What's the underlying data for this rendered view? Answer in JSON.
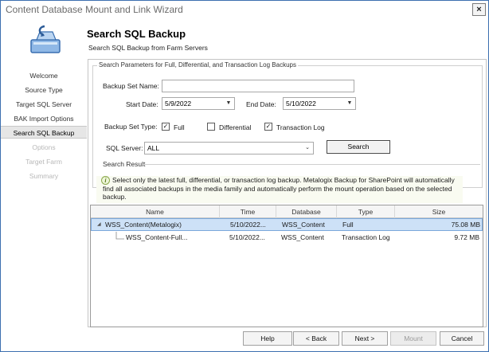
{
  "window": {
    "title": "Content Database Mount and Link Wizard",
    "close_label": "×"
  },
  "header": {
    "title": "Search SQL Backup",
    "subtitle": "Search SQL Backup from Farm Servers"
  },
  "sidebar": {
    "items": [
      {
        "label": "Welcome",
        "state": "normal"
      },
      {
        "label": "Source Type",
        "state": "normal"
      },
      {
        "label": "Target SQL Server",
        "state": "normal"
      },
      {
        "label": "BAK Import Options",
        "state": "normal"
      },
      {
        "label": "Search SQL Backup",
        "state": "active"
      },
      {
        "label": "Options",
        "state": "disabled"
      },
      {
        "label": "Target Farm",
        "state": "disabled"
      },
      {
        "label": "Summary",
        "state": "disabled"
      }
    ]
  },
  "search_params": {
    "legend": "Search Parameters for Full, Differential, and Transaction Log Backups",
    "backup_set_name_label": "Backup Set Name:",
    "backup_set_name_value": "",
    "start_date_label": "Start Date:",
    "start_date_value": "5/9/2022",
    "end_date_label": "End Date:",
    "end_date_value": "5/10/2022",
    "backup_set_type_label": "Backup Set Type:",
    "types": [
      {
        "label": "Full",
        "checked": true
      },
      {
        "label": "Differential",
        "checked": false
      },
      {
        "label": "Transaction Log",
        "checked": true
      }
    ],
    "sql_server_label": "SQL Server:",
    "sql_server_value": "ALL",
    "search_button": "Search"
  },
  "search_result": {
    "label": "Search Result",
    "info_text": "Select only the latest full, differential, or transaction log backup. Metalogix Backup for SharePoint will automatically find all associated backups in the media family and automatically perform the mount operation based on the selected backup.",
    "columns": [
      "Name",
      "Time",
      "Database",
      "Type",
      "Size"
    ],
    "rows": [
      {
        "name": "WSS_Content(Metalogix)",
        "time": "5/10/2022...",
        "database": "WSS_Content",
        "type": "Full",
        "size": "75.08 MB",
        "selected": true,
        "expander": "◢"
      },
      {
        "name": "WSS_Content-Full...",
        "time": "5/10/2022...",
        "database": "WSS_Content",
        "type": "Transaction Log",
        "size": "9.72 MB",
        "selected": false,
        "expander": ""
      }
    ]
  },
  "footer": {
    "help": "Help",
    "back": "< Back",
    "next": "Next >",
    "mount": "Mount",
    "cancel": "Cancel"
  },
  "colors": {
    "accent_border": "#3c6fb0",
    "selection": "#cde1f7",
    "info_bg": "#f9fbf1"
  },
  "icons": {
    "logo": "database-mount-icon",
    "info": "info-icon",
    "dropdown": "chevron-down-icon",
    "checkbox": "check-icon"
  }
}
